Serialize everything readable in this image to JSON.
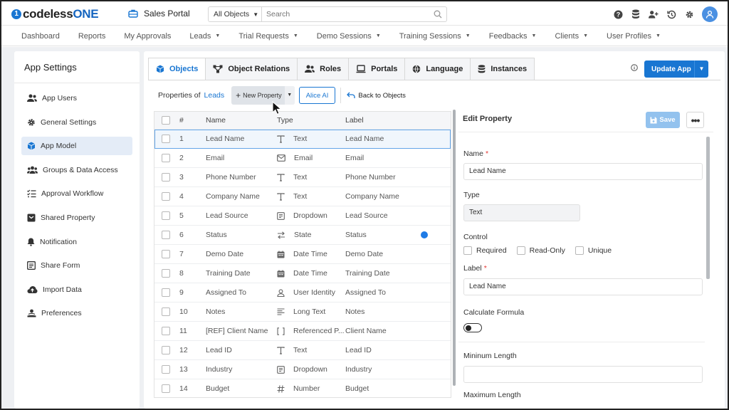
{
  "brand": {
    "logo_mark": "1",
    "logo_text": "codeless",
    "logo_accent": "ONE",
    "app_name": "Sales Portal",
    "accent_color": "#1976d2"
  },
  "search": {
    "scope": "All Objects",
    "placeholder": "Search"
  },
  "top_icons": [
    "help-icon",
    "database-icon",
    "add-user-icon",
    "history-icon",
    "settings-icon",
    "user-avatar-icon"
  ],
  "nav": [
    "Dashboard",
    "Reports",
    "My Approvals",
    "Leads",
    "Trial Requests",
    "Demo Sessions",
    "Training Sessions",
    "Feedbacks",
    "Clients",
    "User Profiles"
  ],
  "nav_dropdowns": [
    false,
    false,
    false,
    true,
    true,
    true,
    true,
    true,
    true,
    true
  ],
  "sidebar": {
    "title": "App Settings",
    "items": [
      {
        "label": "App Users",
        "icon": "users-icon"
      },
      {
        "label": "General Settings",
        "icon": "gear-icon"
      },
      {
        "label": "App Model",
        "icon": "cube-icon",
        "active": true
      },
      {
        "label": "Groups & Data Access",
        "icon": "group-icon"
      },
      {
        "label": "Approval Workflow",
        "icon": "checklist-icon"
      },
      {
        "label": "Shared Property",
        "icon": "shared-icon"
      },
      {
        "label": "Notification",
        "icon": "bell-icon"
      },
      {
        "label": "Share Form",
        "icon": "form-icon"
      },
      {
        "label": "Import Data",
        "icon": "cloud-upload-icon"
      },
      {
        "label": "Preferences",
        "icon": "preferences-icon"
      }
    ]
  },
  "tabs": [
    "Objects",
    "Object Relations",
    "Roles",
    "Portals",
    "Language",
    "Instances"
  ],
  "update_button": "Update App",
  "toolbar": {
    "properties_of": "Properties of",
    "object": "Leads",
    "new_property": "New Property",
    "alice": "Alice AI",
    "back": "Back to Objects"
  },
  "table": {
    "headers": [
      "#",
      "Name",
      "Type",
      "Label"
    ],
    "rows": [
      {
        "n": "1",
        "name": "Lead Name",
        "type": "Text",
        "icon": "text",
        "label": "Lead Name"
      },
      {
        "n": "2",
        "name": "Email",
        "type": "Email",
        "icon": "email",
        "label": "Email"
      },
      {
        "n": "3",
        "name": "Phone Number",
        "type": "Text",
        "icon": "text",
        "label": "Phone Number"
      },
      {
        "n": "4",
        "name": "Company Name",
        "type": "Text",
        "icon": "text",
        "label": "Company Name"
      },
      {
        "n": "5",
        "name": "Lead Source",
        "type": "Dropdown",
        "icon": "dropdown",
        "label": "Lead Source"
      },
      {
        "n": "6",
        "name": "Status",
        "type": "State",
        "icon": "state",
        "label": "Status"
      },
      {
        "n": "7",
        "name": "Demo Date",
        "type": "Date Time",
        "icon": "calendar",
        "label": "Demo Date"
      },
      {
        "n": "8",
        "name": "Training Date",
        "type": "Date Time",
        "icon": "calendar",
        "label": "Training Date"
      },
      {
        "n": "9",
        "name": "Assigned To",
        "type": "User Identity",
        "icon": "user",
        "label": "Assigned To"
      },
      {
        "n": "10",
        "name": "Notes",
        "type": "Long Text",
        "icon": "longtext",
        "label": "Notes"
      },
      {
        "n": "11",
        "name": "[REF] Client Name",
        "type": "Referenced P...",
        "icon": "ref",
        "label": "Client Name"
      },
      {
        "n": "12",
        "name": "Lead ID",
        "type": "Text",
        "icon": "text",
        "label": "Lead ID"
      },
      {
        "n": "13",
        "name": "Industry",
        "type": "Dropdown",
        "icon": "dropdown",
        "label": "Industry"
      },
      {
        "n": "14",
        "name": "Budget",
        "type": "Number",
        "icon": "number",
        "label": "Budget"
      }
    ]
  },
  "edit": {
    "title": "Edit Property",
    "save": "Save",
    "more": "•••",
    "name_label": "Name",
    "name_value": "Lead Name",
    "type_label": "Type",
    "type_value": "Text",
    "control_label": "Control",
    "required": "Required",
    "readonly": "Read-Only",
    "unique": "Unique",
    "label_label": "Label",
    "label_value": "Lead Name",
    "formula_label": "Calculate Formula",
    "min_label": "Mininum Length",
    "min_value": "",
    "max_label": "Maximum Length",
    "required_mark": "*"
  }
}
